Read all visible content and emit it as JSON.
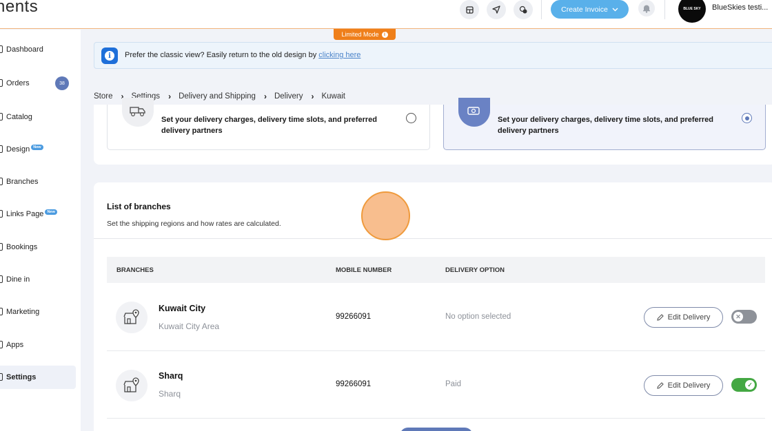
{
  "header": {
    "brand": "nents",
    "create_invoice_label": "Create Invoice",
    "avatar_text": "BLUE SKY",
    "store_name": "BlueSkies testi..."
  },
  "limited_mode": "Limited Mode",
  "sidebar": {
    "items": [
      {
        "label": "Dashboard",
        "icon": "dashboard-icon"
      },
      {
        "label": "Orders",
        "badge": "38",
        "icon": "orders-icon"
      },
      {
        "label": "Catalog",
        "icon": "catalog-icon"
      },
      {
        "label": "Design",
        "tag": "New",
        "icon": "design-icon"
      },
      {
        "label": "Branches",
        "icon": "branches-icon"
      },
      {
        "label": "Links Page",
        "tag": "New",
        "icon": "link-icon"
      },
      {
        "label": "Bookings",
        "icon": "bookings-icon"
      },
      {
        "label": "Dine in",
        "icon": "dine-in-icon"
      },
      {
        "label": "Marketing",
        "icon": "marketing-icon"
      },
      {
        "label": "Apps",
        "icon": "apps-icon"
      },
      {
        "label": "Settings",
        "icon": "settings-icon",
        "active": true
      }
    ]
  },
  "banner": {
    "text": "Prefer the classic view? Easily return to the old design by",
    "link": "clicking here"
  },
  "breadcrumb": [
    "Store",
    "Settings",
    "Delivery and Shipping",
    "Delivery",
    "Kuwait"
  ],
  "delivery_options": [
    {
      "description": "Set your delivery charges, delivery time slots, and preferred delivery partners",
      "selected": false
    },
    {
      "description": "Set your delivery charges, delivery time slots, and preferred delivery partners",
      "selected": true
    }
  ],
  "branches_section": {
    "title": "List of branches",
    "subtitle": "Set the shipping regions and how rates are calculated.",
    "columns": [
      "BRANCHES",
      "MOBILE NUMBER",
      "DELIVERY OPTION"
    ],
    "edit_label": "Edit Delivery",
    "rows": [
      {
        "name": "Kuwait City",
        "area": "Kuwait City Area",
        "mobile": "99266091",
        "delivery_option": "No option selected",
        "enabled": false
      },
      {
        "name": "Sharq",
        "area": "Sharq",
        "mobile": "99266091",
        "delivery_option": "Paid",
        "enabled": true
      }
    ]
  },
  "colors": {
    "accent": "#5f79b8",
    "create_button": "#59b0ea",
    "limited_mode": "#ef7f1a",
    "toggle_on": "#44a843",
    "toggle_off": "#8e9299"
  }
}
